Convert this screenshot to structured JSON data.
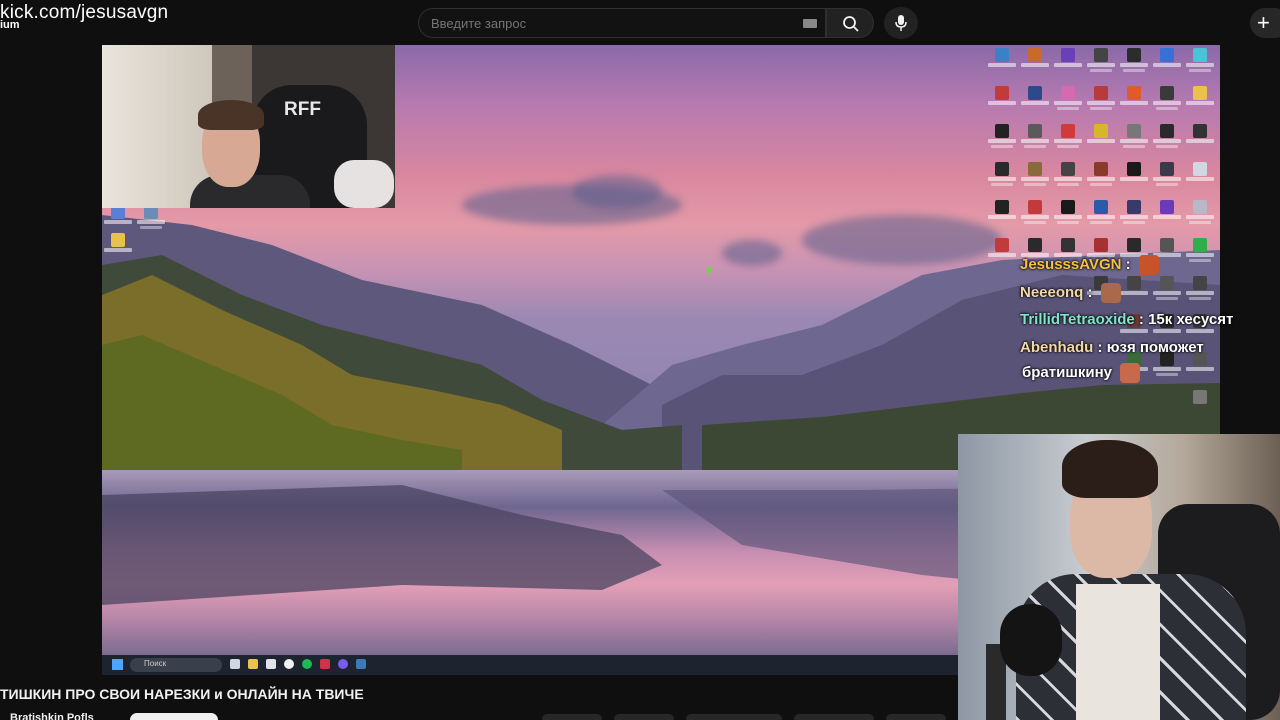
{
  "browser": {
    "stream_url": "kick.com/jesusavgn",
    "channel_tag": "ium"
  },
  "search": {
    "placeholder": "Введите запрос"
  },
  "icons": {
    "keyboard": "keyboard-icon",
    "search": "search-icon",
    "mic": "mic-icon",
    "create": "plus-icon"
  },
  "webcam_overlay": {
    "chair_brand": "RFF"
  },
  "chat": {
    "messages": [
      {
        "user": "JesusssAVGN",
        "sep": ":",
        "text": "",
        "color": "#f6c23e"
      },
      {
        "user": "Neeeonq",
        "sep": ":",
        "text": "",
        "color": "#f3d9a4"
      },
      {
        "user": "TrillidTetraoxide",
        "sep": ":",
        "text": "15к хесусят",
        "color": "#7fe6c8"
      },
      {
        "user": "Abenhadu",
        "sep": ":",
        "text": "юзя поможет",
        "color": "#f3d9a4"
      },
      {
        "user": "",
        "sep": "",
        "text": "братишкину",
        "color": "#ffffff"
      }
    ]
  },
  "taskbar": {
    "search_label": "Поиск"
  },
  "video": {
    "title": "ТИШКИН ПРО СВОИ НАРЕЗКИ и ОНЛАЙН НА ТВИЧЕ",
    "channel": "Bratishkin Pofls"
  }
}
